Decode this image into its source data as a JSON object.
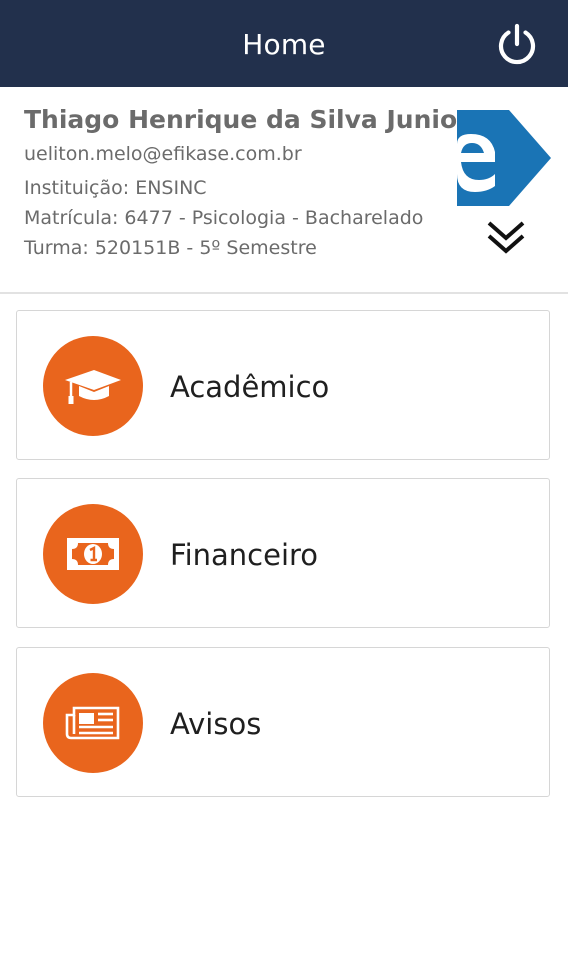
{
  "header": {
    "title": "Home",
    "background": "#22304c",
    "power_icon": "power-icon"
  },
  "profile": {
    "name": "Thiago Henrique da Silva Junior",
    "email": "ueliton.melo@efikase.com.br",
    "institution": "Instituição: ENSINC",
    "enrollment": "Matrícula: 6477 - Psicologia - Bacharelado",
    "class": "Turma: 520151B - 5º Semestre",
    "logo_icon": "efikase-logo",
    "expand_icon": "double-chevron-down-icon"
  },
  "menu": {
    "accent": "#e9651d",
    "items": [
      {
        "label": "Acadêmico",
        "icon": "graduation-cap-icon"
      },
      {
        "label": "Financeiro",
        "icon": "banknote-icon"
      },
      {
        "label": "Avisos",
        "icon": "newspaper-icon"
      }
    ]
  }
}
